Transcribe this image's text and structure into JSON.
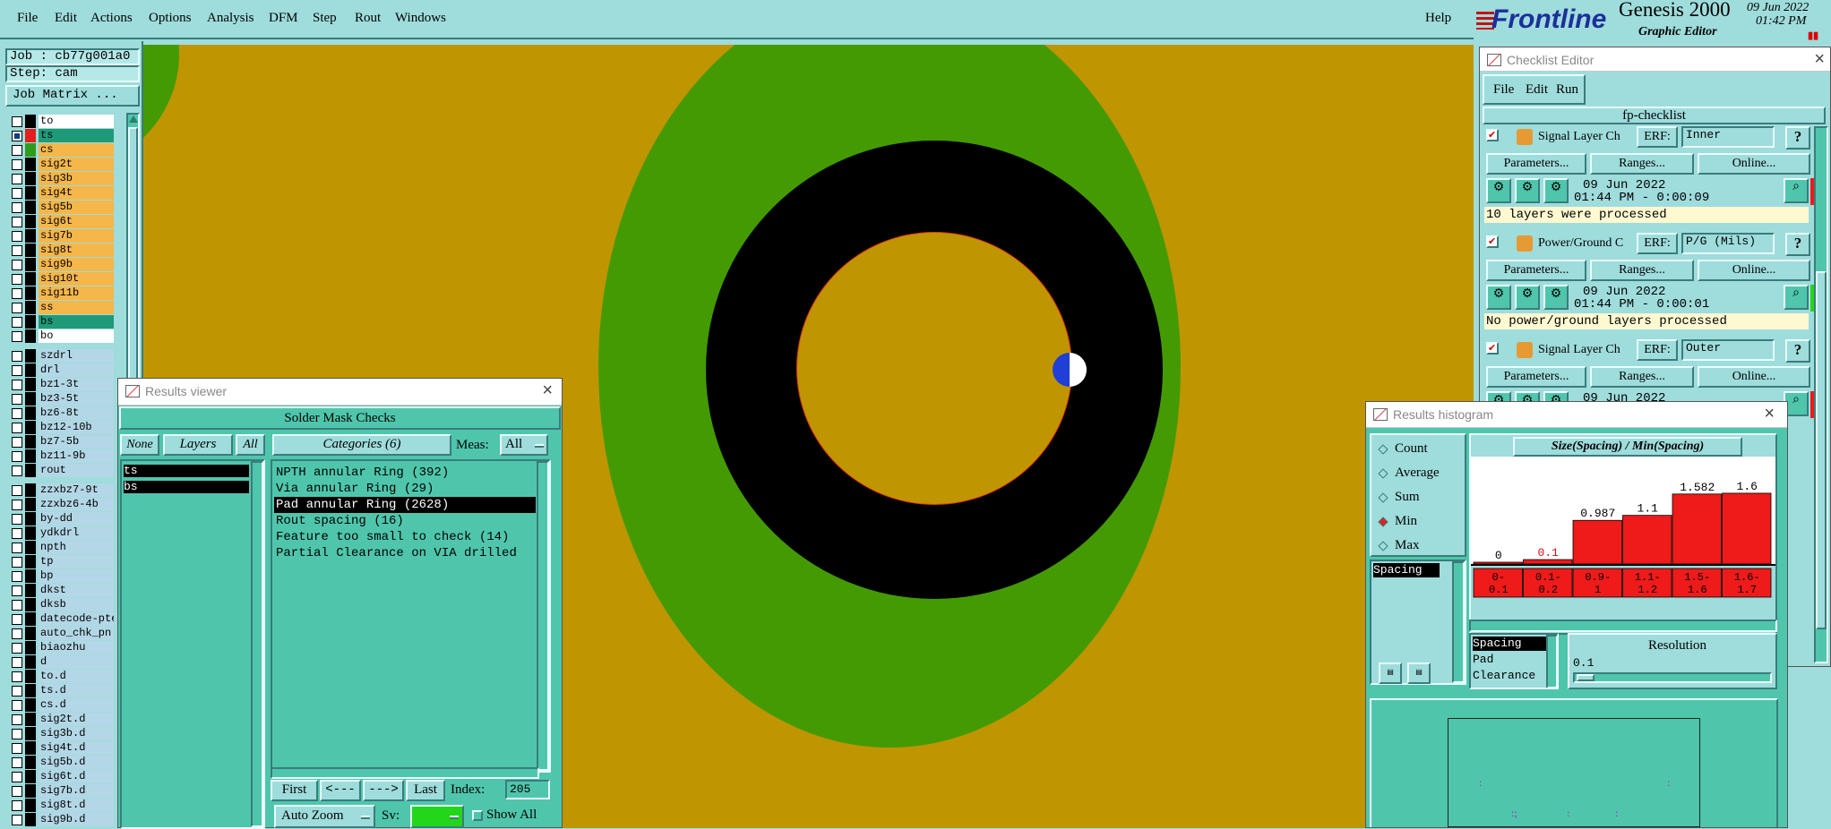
{
  "menubar": {
    "items": [
      "File",
      "Edit",
      "Actions",
      "Options",
      "Analysis",
      "DFM",
      "Step",
      "Rout",
      "Windows"
    ],
    "help": "Help"
  },
  "brand": {
    "logo": "Frontline",
    "product": "Genesis 2000",
    "subtitle": "Graphic Editor",
    "date": "09 Jun 2022",
    "time": "01:42 PM"
  },
  "job": {
    "job_label": "Job : cb77g001a0",
    "step_label": "Step: cam",
    "matrix_button": "Job Matrix ..."
  },
  "layers": {
    "board": [
      {
        "name": "to",
        "color": "#ffffff",
        "checked": false
      },
      {
        "name": "ts",
        "color": "#1e9a78",
        "checked": true,
        "swatch": "#e22020"
      },
      {
        "name": "cs",
        "color": "#f5b64a",
        "checked": false,
        "swatch": "#2f9c19"
      },
      {
        "name": "sig2t",
        "color": "#f5b64a",
        "checked": false
      },
      {
        "name": "sig3b",
        "color": "#f5b64a",
        "checked": false
      },
      {
        "name": "sig4t",
        "color": "#f5b64a",
        "checked": false
      },
      {
        "name": "sig5b",
        "color": "#f5b64a",
        "checked": false
      },
      {
        "name": "sig6t",
        "color": "#f5b64a",
        "checked": false
      },
      {
        "name": "sig7b",
        "color": "#f5b64a",
        "checked": false
      },
      {
        "name": "sig8t",
        "color": "#f5b64a",
        "checked": false
      },
      {
        "name": "sig9b",
        "color": "#f5b64a",
        "checked": false
      },
      {
        "name": "sig10t",
        "color": "#f5b64a",
        "checked": false
      },
      {
        "name": "sig11b",
        "color": "#f5b64a",
        "checked": false
      },
      {
        "name": "ss",
        "color": "#f5b64a",
        "checked": false
      },
      {
        "name": "bs",
        "color": "#1e9a78",
        "checked": false
      },
      {
        "name": "bo",
        "color": "#ffffff",
        "checked": false
      }
    ],
    "drill": [
      "szdrl",
      "drl",
      "bz1-3t",
      "bz3-5t",
      "bz6-8t",
      "bz12-10b",
      "bz7-5b",
      "bz11-9b",
      "rout"
    ],
    "misc": [
      "zzxbz7-9t",
      "zzxbz6-4b",
      "by-dd",
      "ydkdrl",
      "npth",
      "tp",
      "bp",
      "dkst",
      "dksb",
      "datecode-pte",
      "auto_chk_pn",
      "biaozhu",
      "d",
      "to.d",
      "ts.d",
      "cs.d",
      "sig2t.d",
      "sig3b.d",
      "sig4t.d",
      "sig5b.d",
      "sig6t.d",
      "sig7b.d",
      "sig8t.d",
      "sig9b.d"
    ]
  },
  "colors": {
    "board_bg": "#bf9502",
    "copper_green": "#449a02",
    "mask_black": "#000000",
    "panel": "#9fdcdc",
    "panel_dark": "#4fc6ac",
    "highlight_red": "#ef1a1a"
  },
  "results_viewer": {
    "title": "Results viewer",
    "heading": "Solder Mask Checks",
    "none": "None",
    "layers": "Layers",
    "all": "All",
    "categories": "Categories (6)",
    "meas_label": "Meas:",
    "meas_value": "All",
    "layer_items": [
      "ts",
      "bs"
    ],
    "category_items": [
      "NPTH annular Ring (392)",
      "Via annular Ring (29)",
      "Pad annular Ring (2628)",
      "Rout spacing (16)",
      "Feature too small to check (14)",
      "Partial Clearance on VIA drilled"
    ],
    "selected_index": 2,
    "first": "First",
    "prev": "<---",
    "next": "--->",
    "last": "Last",
    "index_label": "Index:",
    "index_value": "205",
    "zoom": "Auto Zoom",
    "sv": "Sv:",
    "show_all": "Show All"
  },
  "checklist": {
    "title": "Checklist Editor",
    "menu": [
      "File",
      "Edit",
      "Run"
    ],
    "name": "fp-checklist",
    "params_btn": "Parameters...",
    "ranges_btn": "Ranges...",
    "online_btn": "Online...",
    "erf_label": "ERF:",
    "items": [
      {
        "name": "Signal Layer Ch",
        "erf": "Inner",
        "date": "09 Jun 2022",
        "time": "01:44 PM - 0:00:09",
        "msg": "10 layers were processed",
        "status": "#ef1a1a"
      },
      {
        "name": "Power/Ground C",
        "erf": "P/G (Mils)",
        "date": "09 Jun 2022",
        "time": "01:44 PM - 0:00:01",
        "msg": "No power/ground layers processed",
        "status": "#24d61a"
      },
      {
        "name": "Signal Layer Ch",
        "erf": "Outer",
        "date": "09 Jun 2022",
        "time": "",
        "msg": "",
        "status": "#ef1a1a"
      }
    ]
  },
  "histogram": {
    "title": "Results histogram",
    "modes": [
      "Count",
      "Average",
      "Sum",
      "Min",
      "Max"
    ],
    "selected_mode": "Min",
    "chart_title": "Size(Spacing) / Min(Spacing)",
    "category_list": [
      "Spacing"
    ],
    "measure_list": [
      "Spacing",
      "Pad",
      "Clearance"
    ],
    "resolution_label": "Resolution",
    "resolution_value": "0.1"
  },
  "chart_data": {
    "type": "bar",
    "title": "Size(Spacing) / Min(Spacing)",
    "categories": [
      "0-0.1",
      "0.1-0.2",
      "0.9-1",
      "1.1-1.2",
      "1.5-1.6",
      "1.6-1.7"
    ],
    "category_lines": [
      [
        "0-",
        "0.1"
      ],
      [
        "0.1-",
        "0.2"
      ],
      [
        "0.9-",
        "1"
      ],
      [
        "1.1-",
        "1.2"
      ],
      [
        "1.5-",
        "1.6"
      ],
      [
        "1.6-",
        "1.7"
      ]
    ],
    "values": [
      0,
      0.1,
      0.987,
      1.1,
      1.582,
      1.6
    ],
    "labels": [
      "0",
      "0.1",
      "0.987",
      "1.1",
      "1.582",
      "1.6"
    ],
    "ylim": [
      0,
      1.7
    ],
    "bar_color": "#ef1a1a"
  }
}
